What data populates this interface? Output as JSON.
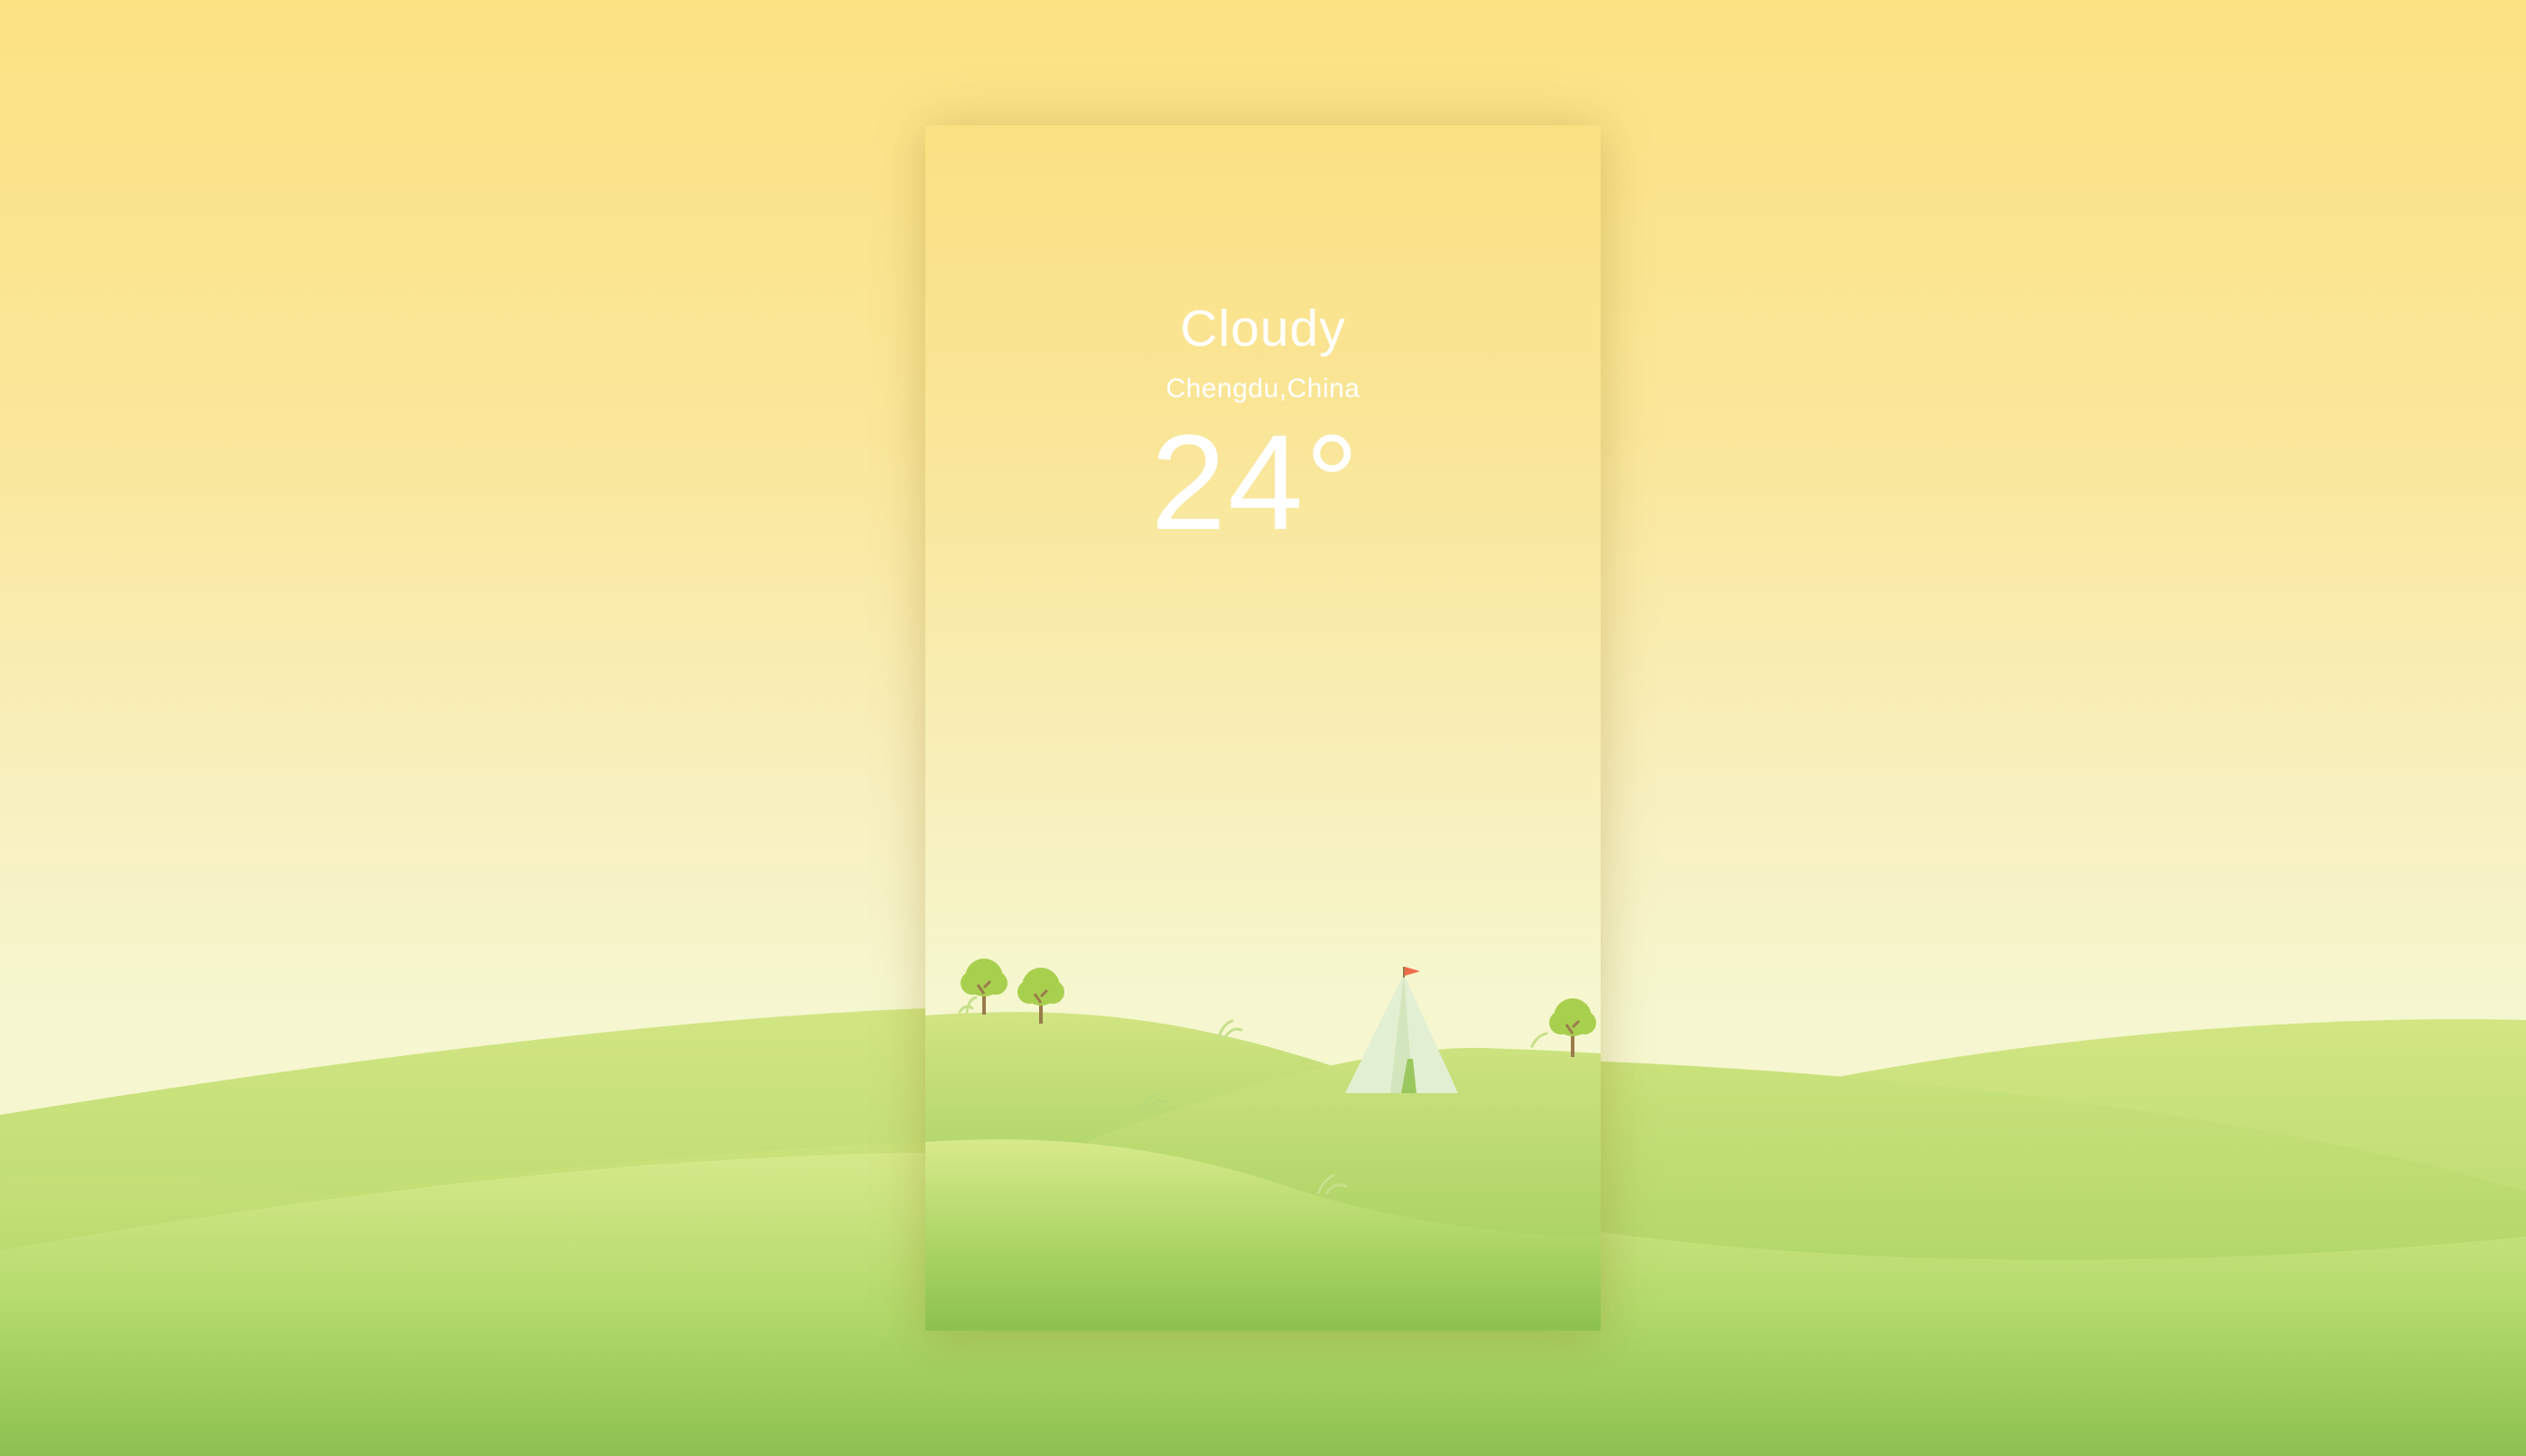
{
  "weather": {
    "condition": "Cloudy",
    "location": "Chengdu,China",
    "temperature": "24°"
  },
  "colors": {
    "sky_top": "#fce283",
    "sky_bottom": "#f4f8d2",
    "hill_light": "#cfe37f",
    "hill_dark": "#8cc151",
    "tree_foliage": "#a9cf4f",
    "tree_trunk": "#9a7b4a",
    "tent": "#e3efd2",
    "flag": "#f06a4a"
  },
  "icons": [
    "tree-icon",
    "tent-icon",
    "flag-icon",
    "grass-icon"
  ]
}
